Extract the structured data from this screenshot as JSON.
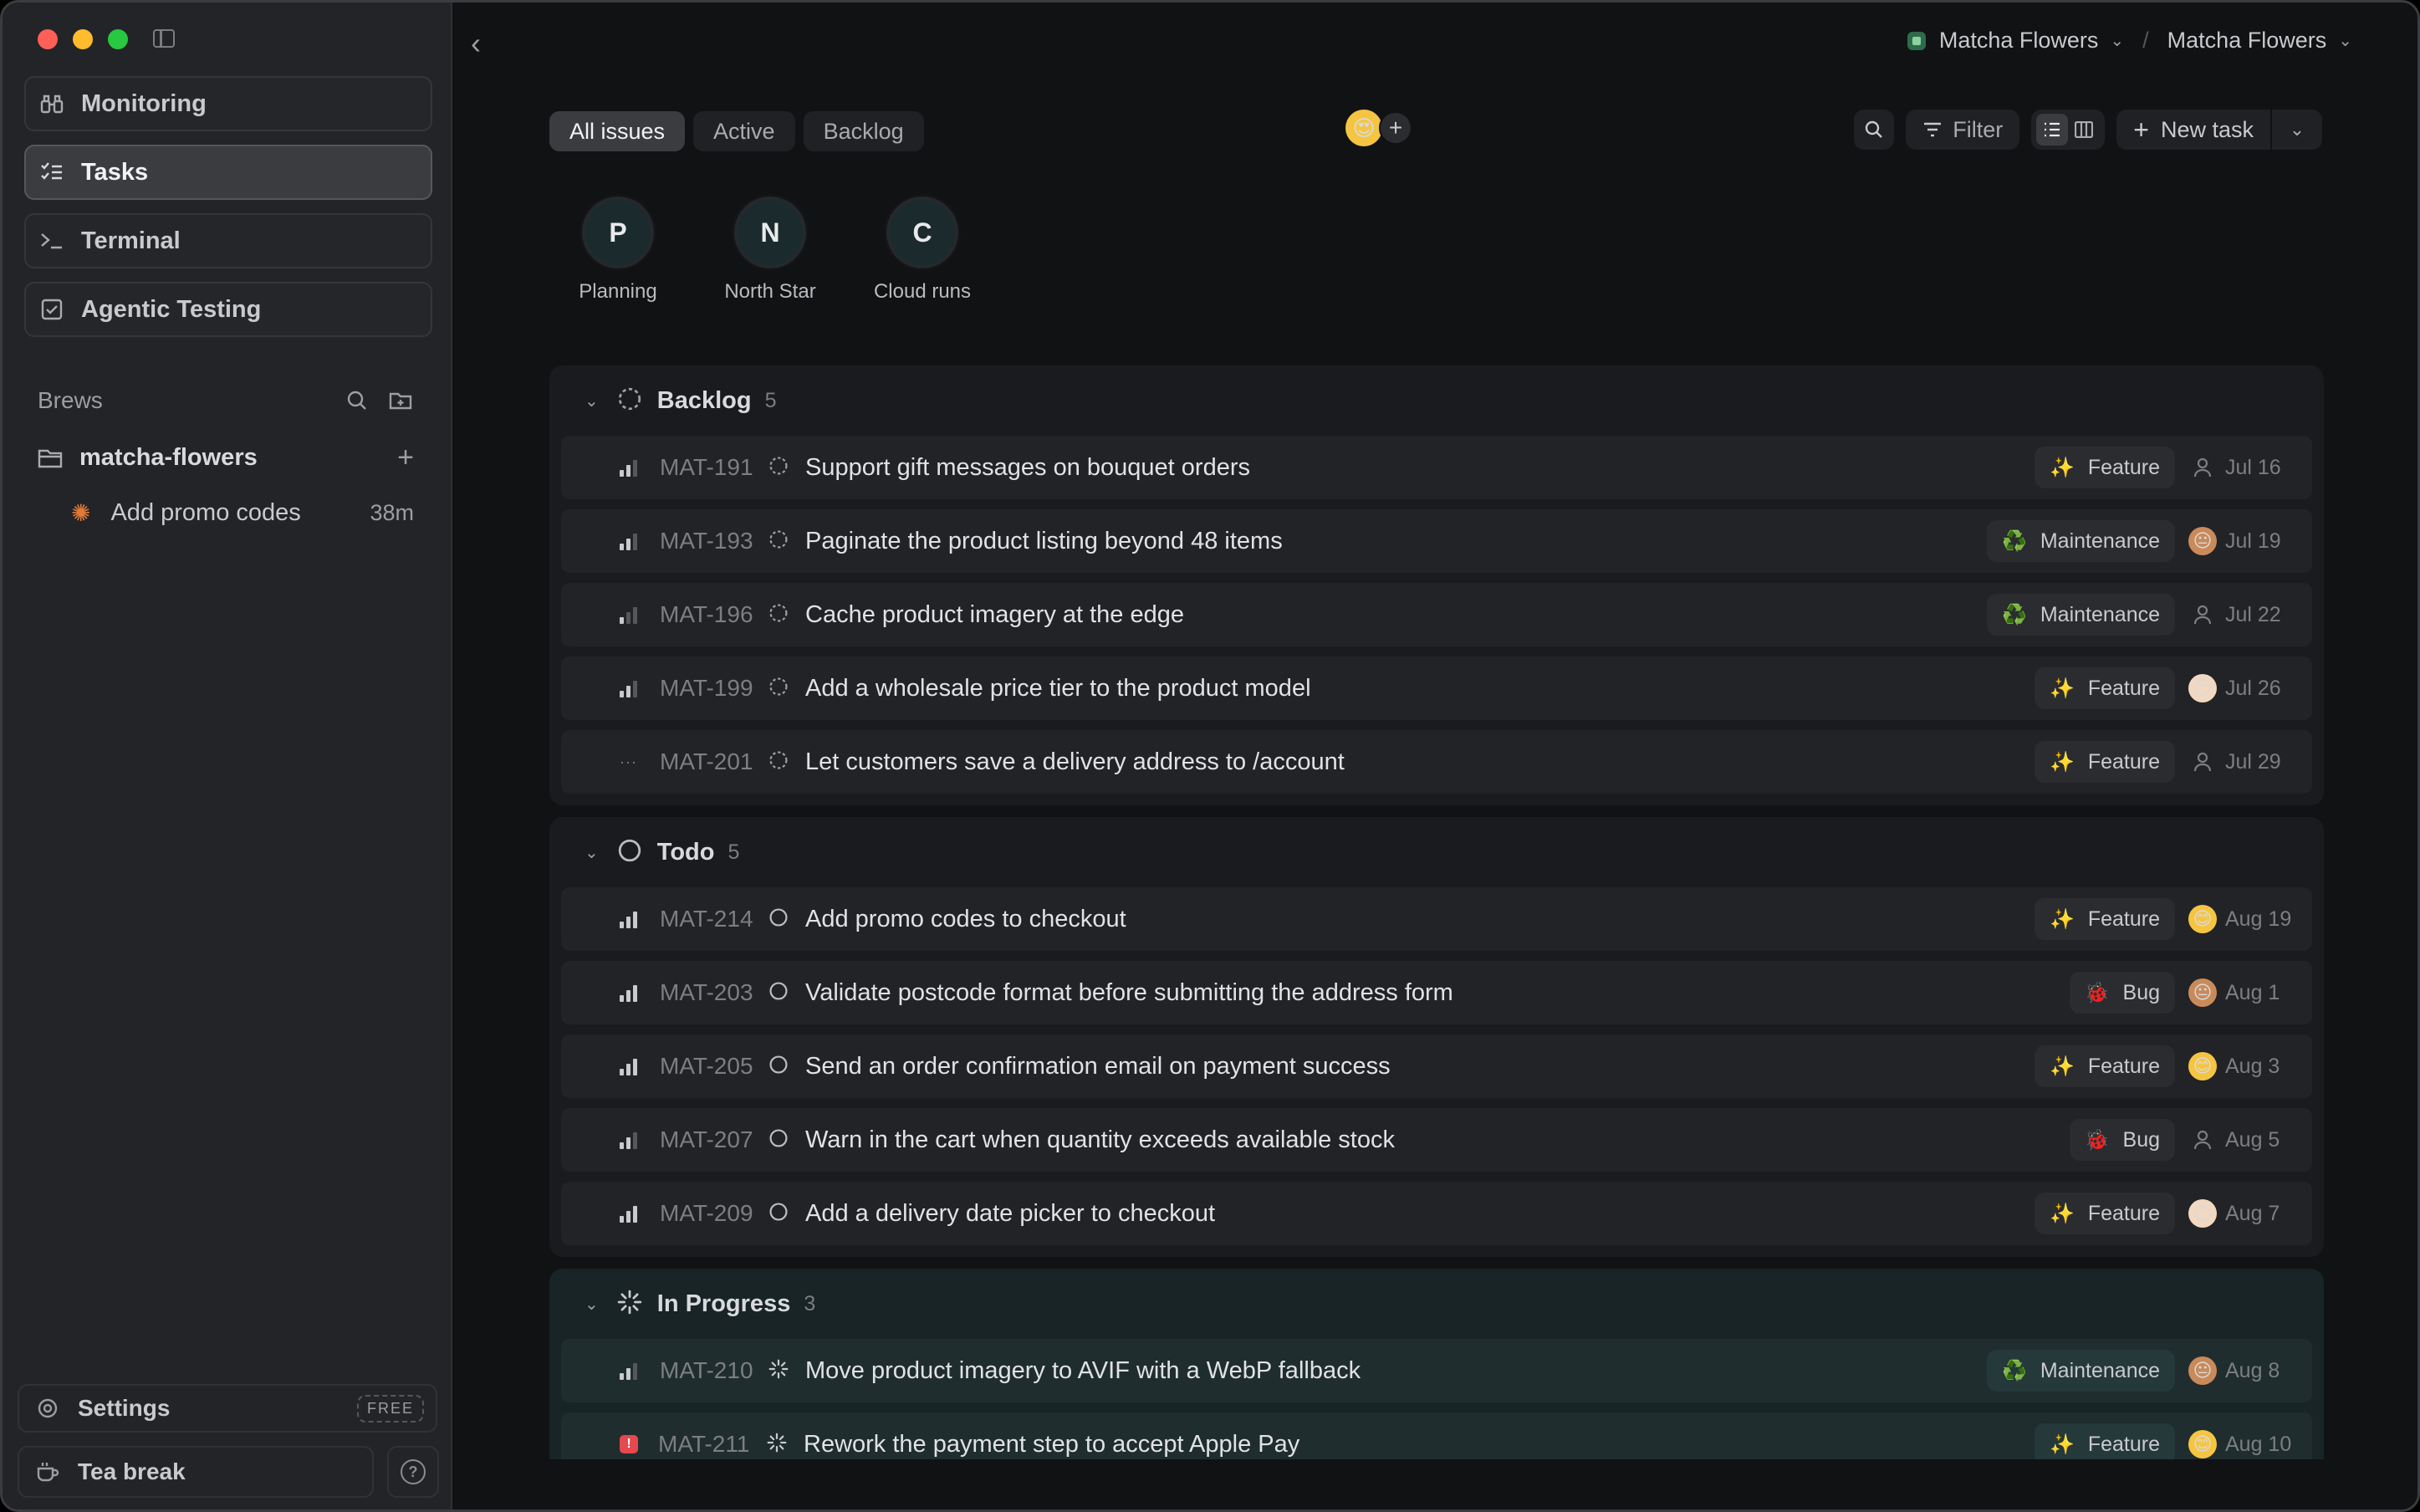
{
  "sidebar": {
    "nav": [
      {
        "label": "Monitoring",
        "icon": "binoculars-icon"
      },
      {
        "label": "Tasks",
        "icon": "tasks-icon",
        "active": true
      },
      {
        "label": "Terminal",
        "icon": "terminal-icon"
      },
      {
        "label": "Agentic Testing",
        "icon": "checkbox-icon"
      }
    ],
    "brews_title": "Brews",
    "project_name": "matcha-flowers",
    "brew_task": {
      "label": "Add promo codes",
      "time": "38m"
    },
    "settings_label": "Settings",
    "plan_badge": "FREE",
    "tea_break_label": "Tea break"
  },
  "header": {
    "workspace": "Matcha Flowers",
    "project": "Matcha Flowers"
  },
  "toolbar": {
    "tabs": [
      "All issues",
      "Active",
      "Backlog"
    ],
    "filter_label": "Filter",
    "new_task_label": "New task"
  },
  "views": [
    {
      "letter": "P",
      "label": "Planning"
    },
    {
      "letter": "N",
      "label": "North Star"
    },
    {
      "letter": "C",
      "label": "Cloud runs"
    }
  ],
  "groups": [
    {
      "name": "Backlog",
      "count": "5",
      "status": "backlog",
      "rows": [
        {
          "id": "MAT-191",
          "title": "Support gift messages on bouquet orders",
          "tag": "Feature",
          "date": "Jul 16",
          "prio": "medium",
          "assignee": "none"
        },
        {
          "id": "MAT-193",
          "title": "Paginate the product listing beyond 48 items",
          "tag": "Maintenance",
          "date": "Jul 19",
          "prio": "medium",
          "assignee": "brown"
        },
        {
          "id": "MAT-196",
          "title": "Cache product imagery at the edge",
          "tag": "Maintenance",
          "date": "Jul 22",
          "prio": "low",
          "assignee": "none"
        },
        {
          "id": "MAT-199",
          "title": "Add a wholesale price tier to the product model",
          "tag": "Feature",
          "date": "Jul 26",
          "prio": "medium",
          "assignee": "pale"
        },
        {
          "id": "MAT-201",
          "title": "Let customers save a delivery address to /account",
          "tag": "Feature",
          "date": "Jul 29",
          "prio": "none",
          "assignee": "none"
        }
      ]
    },
    {
      "name": "Todo",
      "count": "5",
      "status": "todo",
      "rows": [
        {
          "id": "MAT-214",
          "title": "Add promo codes to checkout",
          "tag": "Feature",
          "date": "Aug 19",
          "prio": "high",
          "assignee": "yellow"
        },
        {
          "id": "MAT-203",
          "title": "Validate postcode format before submitting the address form",
          "tag": "Bug",
          "date": "Aug 1",
          "prio": "high",
          "assignee": "brown"
        },
        {
          "id": "MAT-205",
          "title": "Send an order confirmation email on payment success",
          "tag": "Feature",
          "date": "Aug 3",
          "prio": "high",
          "assignee": "yellow"
        },
        {
          "id": "MAT-207",
          "title": "Warn in the cart when quantity exceeds available stock",
          "tag": "Bug",
          "date": "Aug 5",
          "prio": "medium",
          "assignee": "none"
        },
        {
          "id": "MAT-209",
          "title": "Add a delivery date picker to checkout",
          "tag": "Feature",
          "date": "Aug 7",
          "prio": "high",
          "assignee": "pale"
        }
      ]
    },
    {
      "name": "In Progress",
      "count": "3",
      "status": "progress",
      "rows": [
        {
          "id": "MAT-210",
          "title": "Move product imagery to AVIF with a WebP fallback",
          "tag": "Maintenance",
          "date": "Aug 8",
          "prio": "medium",
          "assignee": "brown"
        },
        {
          "id": "MAT-211",
          "title": "Rework the payment step to accept Apple Pay",
          "tag": "Feature",
          "date": "Aug 10",
          "prio": "urgent",
          "assignee": "yellow"
        }
      ]
    }
  ],
  "tag_icons": {
    "Feature": "✨",
    "Maintenance": "♻️",
    "Bug": "🐞"
  },
  "colors": {
    "accent_urgent": "#e5484d",
    "sidebar_bg": "#222427",
    "main_bg": "#101214"
  }
}
